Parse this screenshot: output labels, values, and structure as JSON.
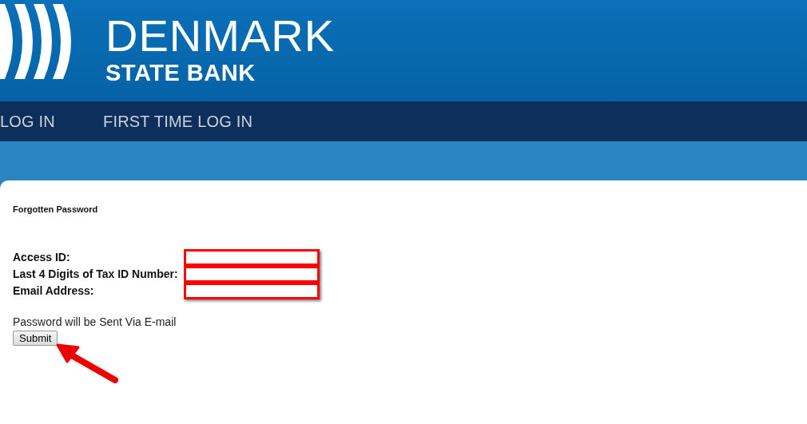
{
  "header": {
    "logo_title": "DENMARK",
    "logo_subtitle": "STATE BANK"
  },
  "nav": [
    {
      "label": "LOG IN"
    },
    {
      "label": "FIRST TIME LOG IN"
    }
  ],
  "form": {
    "heading": "Forgotten Password",
    "fields": [
      {
        "label": "Access ID:"
      },
      {
        "label": "Last 4 Digits of Tax ID Number:"
      },
      {
        "label": "Email Address:"
      }
    ],
    "note": "Password will be Sent Via E-mail",
    "submit": "Submit"
  }
}
